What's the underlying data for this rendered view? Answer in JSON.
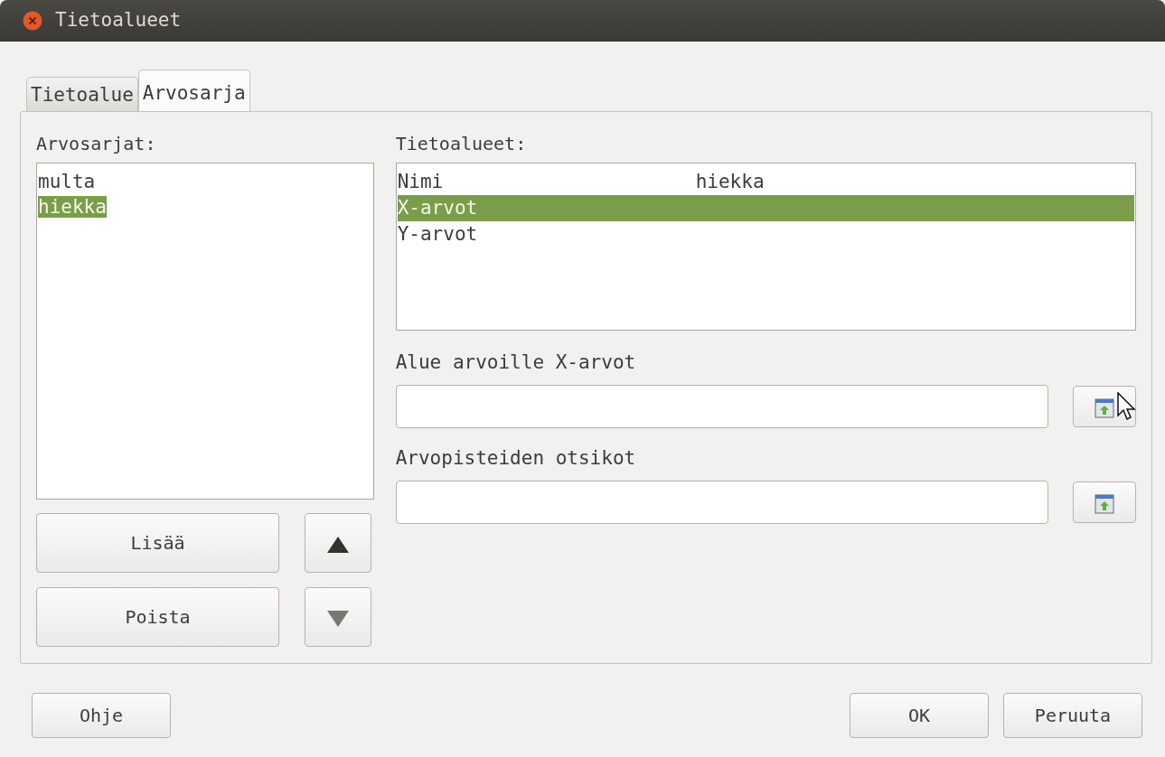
{
  "window": {
    "title": "Tietoalueet"
  },
  "tabs": [
    {
      "label": "Tietoalue",
      "selected": false
    },
    {
      "label": "Arvosarja",
      "selected": true
    }
  ],
  "series_panel": {
    "label": "Arvosarjat:",
    "items": [
      {
        "label": "multa",
        "selected": false
      },
      {
        "label": "hiekka",
        "selected": true
      }
    ],
    "buttons": [
      {
        "label": "Lisää"
      },
      {
        "label": "Poista"
      }
    ],
    "move_buttons": [
      {
        "kind": "up",
        "disabled": false
      },
      {
        "kind": "down",
        "disabled": true
      }
    ]
  },
  "ranges_panel": {
    "label": "Tietoalueet:",
    "rows": [
      {
        "name": "Nimi",
        "value": "hiekka",
        "selected": false
      },
      {
        "name": "X-arvot",
        "selected": true
      },
      {
        "name": "Y-arvot",
        "selected": false
      }
    ],
    "fields": [
      {
        "label": "Alue arvoille X-arvot"
      },
      {
        "label": "Arvopisteiden otsikot"
      }
    ]
  },
  "footer": {
    "help": "Ohje",
    "ok": "OK",
    "cancel": "Peruuta"
  }
}
